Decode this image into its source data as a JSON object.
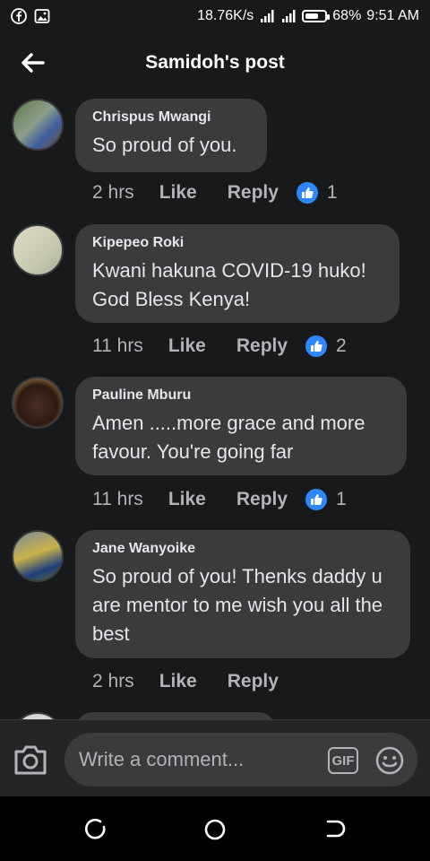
{
  "status_bar": {
    "speed": "18.76K/s",
    "battery": "68%",
    "battery_level": 0.68,
    "time": "9:51 AM"
  },
  "header": {
    "title": "Samidoh's post"
  },
  "comments": [
    {
      "author": "Chrispus Mwangi",
      "text": "So proud of you.",
      "time": "2 hrs",
      "like": "Like",
      "reply": "Reply",
      "reactions": "1"
    },
    {
      "author": "Kipepeo Roki",
      "text": "Kwani hakuna COVID-19 huko! God Bless Kenya!",
      "time": "11 hrs",
      "like": "Like",
      "reply": "Reply",
      "reactions": "2"
    },
    {
      "author": "Pauline Mburu",
      "text": "Amen .....more grace and more favour. You're going far",
      "time": "11 hrs",
      "like": "Like",
      "reply": "Reply",
      "reactions": "1"
    },
    {
      "author": "Jane Wanyoike",
      "text": "So proud of you! Thenks daddy u are mentor to me wish you all the best",
      "time": "2 hrs",
      "like": "Like",
      "reply": "Reply",
      "reactions": ""
    }
  ],
  "composer": {
    "placeholder": "Write a comment...",
    "gif_label": "GIF"
  },
  "colors": {
    "background": "#18191a",
    "bubble": "#3a3b3c",
    "accent": "#2d88ff",
    "muted": "#b0b3b8"
  }
}
